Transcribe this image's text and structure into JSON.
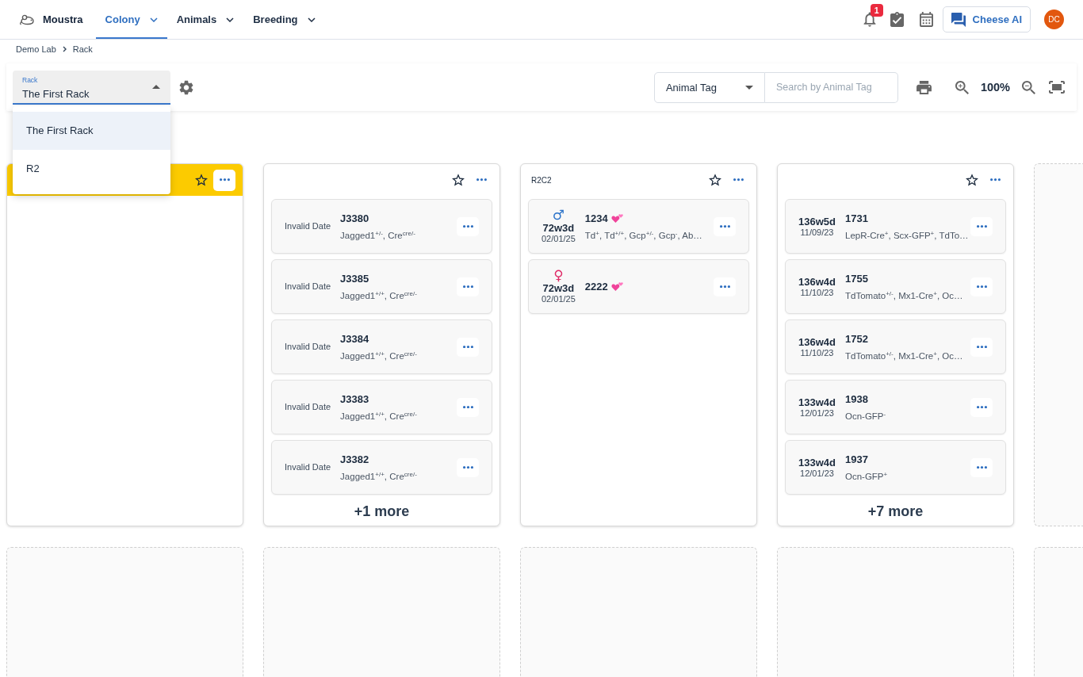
{
  "nav": {
    "brand": "Moustra",
    "menus": [
      {
        "label": "Colony",
        "selected": true
      },
      {
        "label": "Animals",
        "selected": false
      },
      {
        "label": "Breeding",
        "selected": false
      }
    ],
    "notification_count": "1",
    "assistant_button": "Cheese AI",
    "avatar_initials": "DC"
  },
  "breadcrumb": [
    "Demo Lab",
    "Rack"
  ],
  "toolbar": {
    "rack_select": {
      "label": "Rack",
      "value": "The First Rack",
      "expanded": true,
      "options": [
        {
          "label": "The First Rack",
          "selected": true
        },
        {
          "label": "R2",
          "selected": false
        }
      ]
    },
    "search": {
      "filter": "Animal Tag",
      "placeholder": "Search by Animal Tag"
    },
    "zoom_level": "100%"
  },
  "cages": [
    {
      "kind": "cage",
      "highlighted": true,
      "starred": false
    },
    {
      "kind": "cage",
      "highlighted": false,
      "starred": false,
      "animals": [
        {
          "birth_date": "Invalid Date",
          "tag": "J3380",
          "paired": false,
          "genotype": "Jagged1$^{+/-}$, Cre$^{cre/-}$"
        },
        {
          "birth_date": "Invalid Date",
          "tag": "J3385",
          "paired": false,
          "genotype": "Jagged1$^{+/+}$, Cre$^{cre/-}$"
        },
        {
          "birth_date": "Invalid Date",
          "tag": "J3384",
          "paired": false,
          "genotype": "Jagged1$^{+/+}$, Cre$^{cre/-}$"
        },
        {
          "birth_date": "Invalid Date",
          "tag": "J3383",
          "paired": false,
          "genotype": "Jagged1$^{+/+}$, Cre$^{cre/-}$"
        },
        {
          "birth_date": "Invalid Date",
          "tag": "J3382",
          "paired": false,
          "genotype": "Jagged1$^{+/+}$, Cre$^{cre/-}$"
        }
      ],
      "more": "+1 more"
    },
    {
      "kind": "cage",
      "name": "R2C2",
      "highlighted": false,
      "starred": false,
      "animals": [
        {
          "sex_symbol": "♂",
          "color": "#2b73c9",
          "age": "72w3d",
          "birth_date": "02/01/25",
          "tag": "1234",
          "paired": true,
          "genotype": "Td$^{+}$, Td$^{+/+}$, Gcp$^{+/-}$, Gcp$^{-}$, Ab…"
        },
        {
          "sex_symbol": "♀",
          "color": "#df2a66",
          "age": "72w3d",
          "birth_date": "02/01/25",
          "tag": "2222",
          "paired": true
        }
      ]
    },
    {
      "kind": "cage",
      "highlighted": false,
      "starred": false,
      "animals": [
        {
          "age": "136w5d",
          "birth_date": "11/09/23",
          "tag": "1731",
          "paired": false,
          "genotype": "LepR-Cre$^{+}$, Scx-GFP$^{+}$, TdTo…"
        },
        {
          "age": "136w4d",
          "birth_date": "11/10/23",
          "tag": "1755",
          "paired": false,
          "genotype": "TdTomato$^{+/-}$, Mx1-Cre$^{+}$, Oc…"
        },
        {
          "age": "136w4d",
          "birth_date": "11/10/23",
          "tag": "1752",
          "paired": false,
          "genotype": "TdTomato$^{+/-}$, Mx1-Cre$^{+}$, Oc…"
        },
        {
          "age": "133w4d",
          "birth_date": "12/01/23",
          "tag": "1938",
          "paired": false,
          "genotype": "Ocn-GFP$^{-}$"
        },
        {
          "age": "133w4d",
          "birth_date": "12/01/23",
          "tag": "1937",
          "paired": false,
          "genotype": "Ocn-GFP$^{+}$"
        }
      ],
      "more": "+7 more"
    },
    {
      "kind": "empty"
    },
    {
      "kind": "empty"
    },
    {
      "kind": "empty"
    },
    {
      "kind": "empty"
    },
    {
      "kind": "empty"
    },
    {
      "kind": "empty"
    }
  ]
}
